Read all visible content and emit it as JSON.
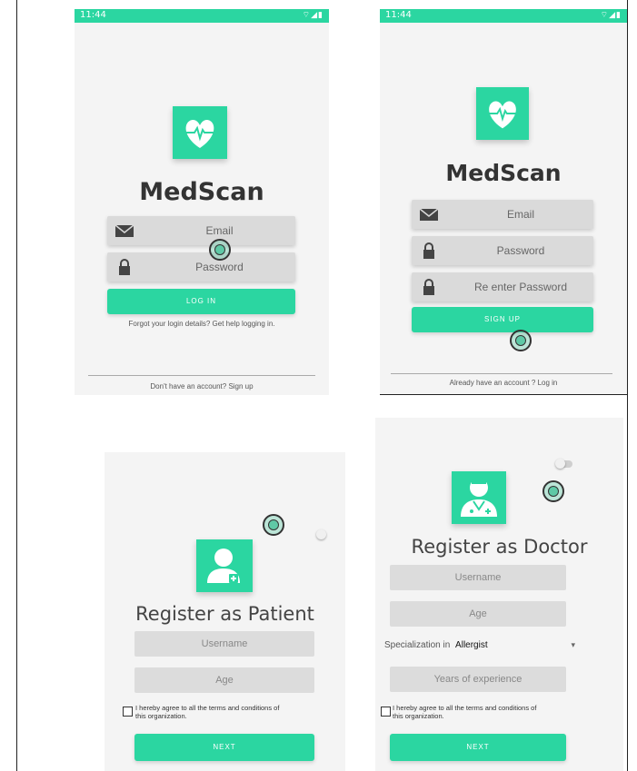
{
  "status_bar": {
    "time": "11:44",
    "icons": "⌔◢▮"
  },
  "login": {
    "app_name": "MedScan",
    "email_placeholder": "Email",
    "password_placeholder": "Password",
    "login_button": "LOG IN",
    "forgot_text": "Forgot your login details? Get help logging in.",
    "signup_text": "Don't have an account? Sign up"
  },
  "signup": {
    "app_name": "MedScan",
    "email_placeholder": "Email",
    "password_placeholder": "Password",
    "reenter_placeholder": "Re enter Password",
    "signup_button": "SIGN UP",
    "login_text": "Already have an account ? Log in"
  },
  "patient": {
    "title": "Register as Patient",
    "username_placeholder": "Username",
    "age_placeholder": "Age",
    "agree_line1": "I hereby agree to all the terms and conditions of",
    "agree_line2": "this organization.",
    "next_button": "NEXT"
  },
  "doctor": {
    "title": "Register as Doctor",
    "username_placeholder": "Username",
    "age_placeholder": "Age",
    "specialization_label": "Specialization in",
    "specialization_value": "Allergist",
    "dropdown_arrow": "▾",
    "experience_placeholder": "Years of experience",
    "agree_line1": "I hereby agree to all the terms and conditions of",
    "agree_line2": "this organization.",
    "next_button": "NEXT"
  },
  "colors": {
    "accent": "#2bd6a1",
    "field": "#dadada",
    "background": "#f4f4f4"
  }
}
